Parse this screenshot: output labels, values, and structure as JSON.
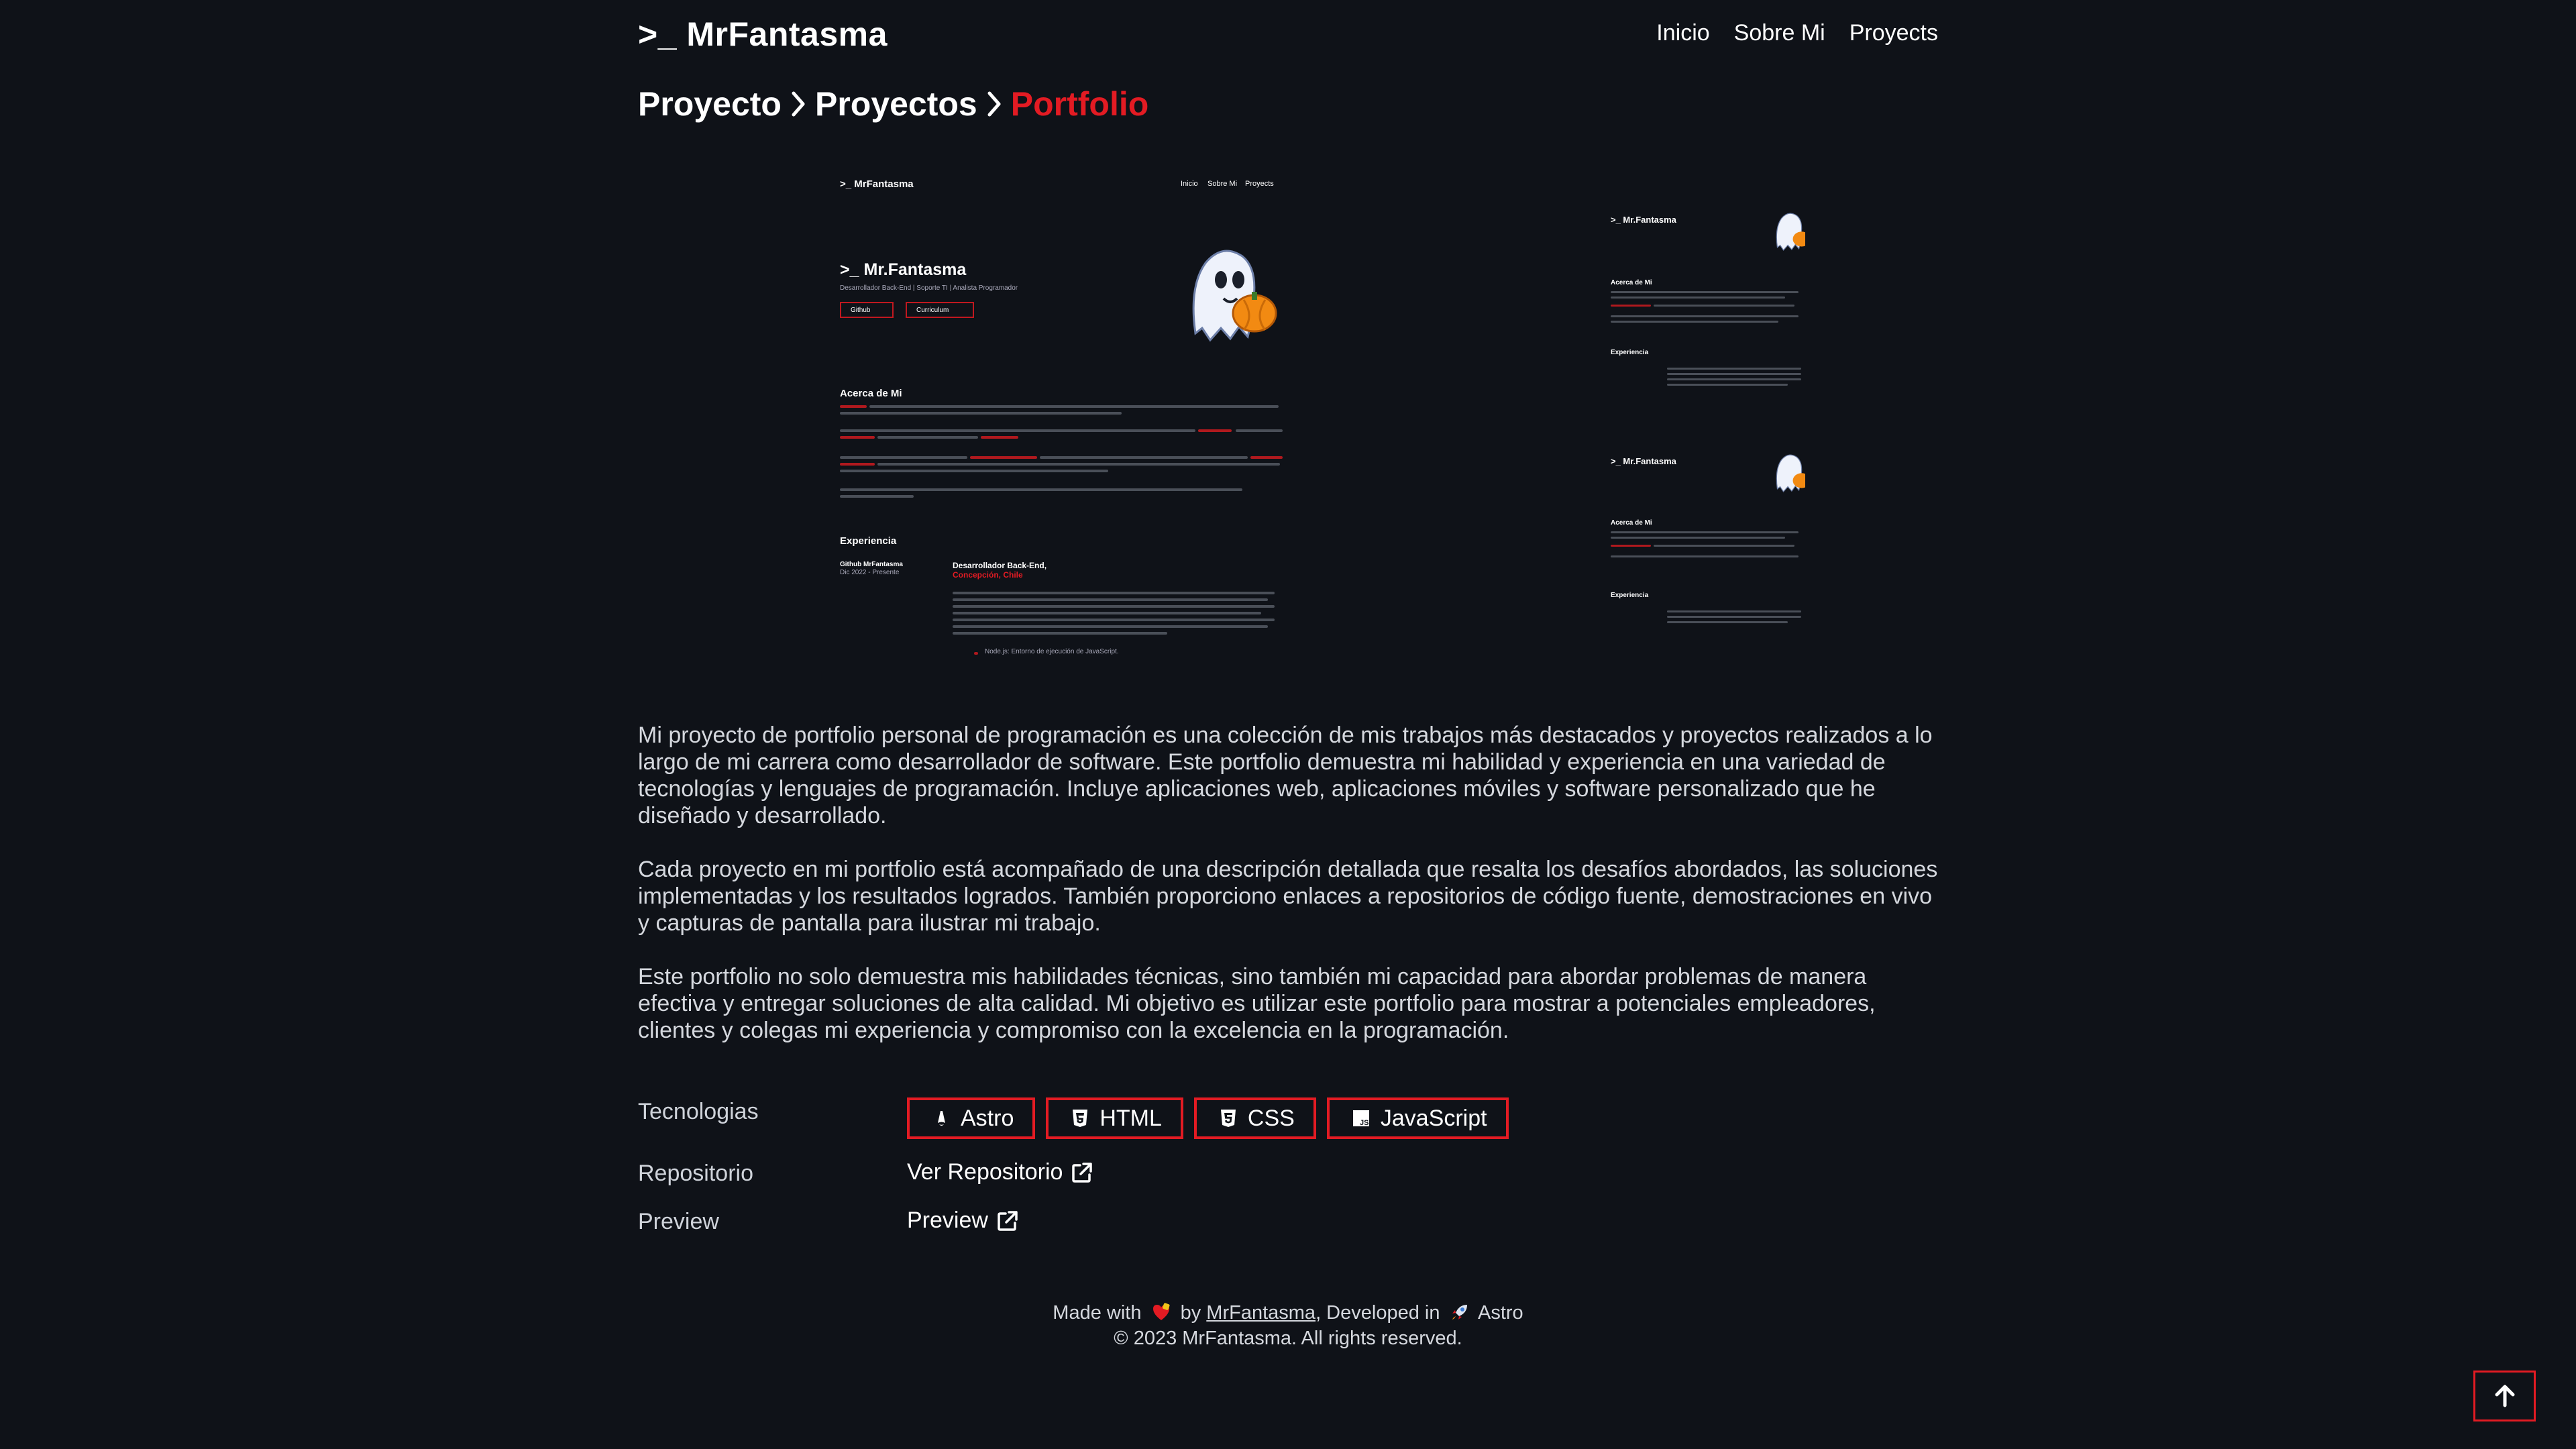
{
  "header": {
    "logo": ">_ MrFantasma",
    "nav": [
      "Inicio",
      "Sobre Mi",
      "Proyects"
    ]
  },
  "breadcrumb": {
    "items": [
      "Proyecto",
      "Proyectos"
    ],
    "current": "Portfolio"
  },
  "preview_desktop": {
    "logo": ">_ MrFantasma",
    "nav": [
      "Inicio",
      "Sobre Mi",
      "Proyects"
    ],
    "name": ">_ Mr.Fantasma",
    "subtitle": "Desarrollador Back-End | Soporte TI | Analista Programador",
    "buttons": [
      "Github",
      "Curriculum"
    ],
    "section_about": "Acerca de Mi",
    "section_experience": "Experiencia",
    "company": "Github MrFantasma",
    "period": "Dic 2022 - Presente",
    "role": "Desarrollador Back-End,",
    "location": "Concepción, Chile",
    "bullet": "Node.js: Entorno de ejecución de JavaScript."
  },
  "preview_mobile": {
    "name": ">_ Mr.Fantasma",
    "section_about": "Acerca de Mi",
    "section_experience": "Experiencia"
  },
  "description": [
    "Mi proyecto de portfolio personal de programación es una colección de mis trabajos más destacados y proyectos realizados a lo largo de mi carrera como desarrollador de software. Este portfolio demuestra mi habilidad y experiencia en una variedad de tecnologías y lenguajes de programación. Incluye aplicaciones web, aplicaciones móviles y software personalizado que he diseñado y desarrollado.",
    "Cada proyecto en mi portfolio está acompañado de una descripción detallada que resalta los desafíos abordados, las soluciones implementadas y los resultados logrados. También proporciono enlaces a repositorios de código fuente, demostraciones en vivo y capturas de pantalla para ilustrar mi trabajo.",
    "Este portfolio no solo demuestra mis habilidades técnicas, sino también mi capacidad para abordar problemas de manera efectiva y entregar soluciones de alta calidad. Mi objetivo es utilizar este portfolio para mostrar a potenciales empleadores, clientes y colegas mi experiencia y compromiso con la excelencia en la programación."
  ],
  "meta": {
    "tech_label": "Tecnologias",
    "technologies": [
      {
        "name": "Astro",
        "icon": "astro-icon"
      },
      {
        "name": "HTML",
        "icon": "html5-icon"
      },
      {
        "name": "CSS",
        "icon": "css3-icon"
      },
      {
        "name": "JavaScript",
        "icon": "javascript-icon"
      }
    ],
    "repo_label": "Repositorio",
    "repo_link": "Ver Repositorio",
    "preview_label": "Preview",
    "preview_link": "Preview"
  },
  "footer": {
    "made_with": "Made with",
    "by": "by",
    "author": "MrFantasma",
    "developed_in": ", Developed in",
    "framework": "Astro",
    "copyright": "© 2023 MrFantasma. All rights reserved."
  },
  "colors": {
    "background": "#0f1218",
    "accent": "#e31b23",
    "text": "#ffffff",
    "muted": "#d5d8de"
  }
}
